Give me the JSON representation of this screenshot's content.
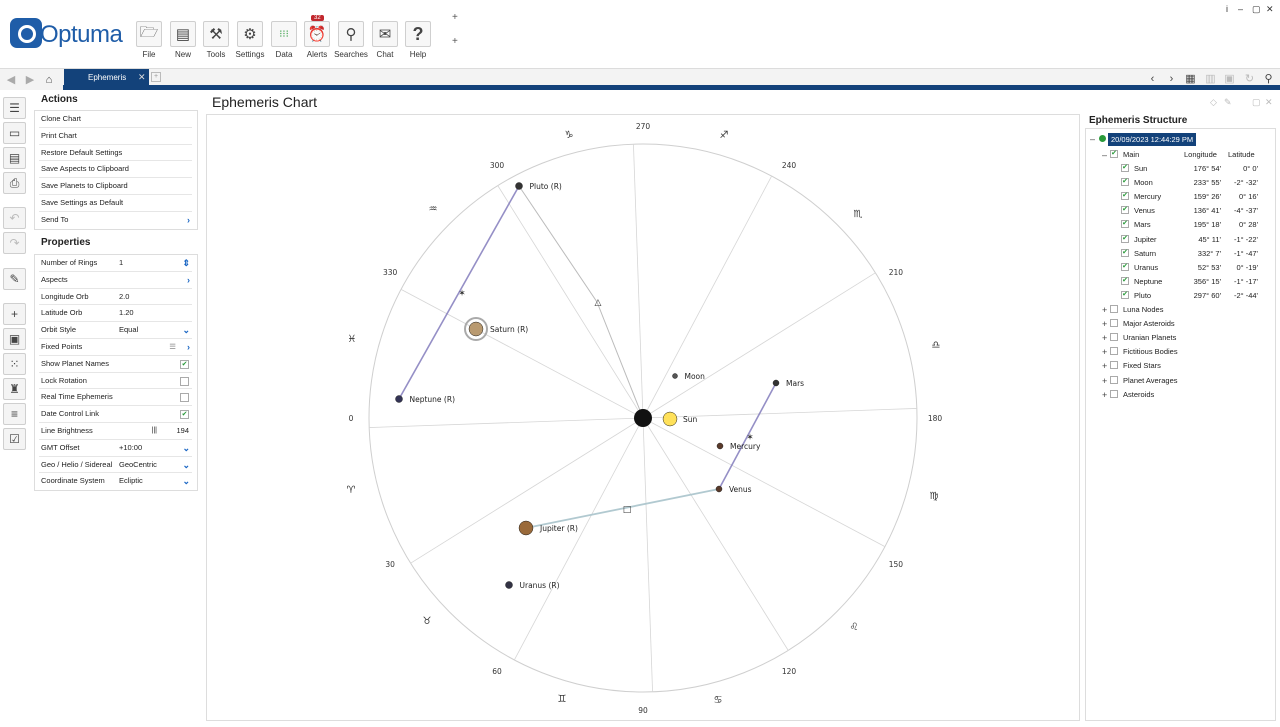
{
  "app": {
    "logo": "Optuma",
    "window_controls": [
      "i",
      "–",
      "▢",
      "✕"
    ]
  },
  "ribbon": {
    "buttons": [
      {
        "label": "File",
        "icon": "folder-icon"
      },
      {
        "label": "New",
        "icon": "new-chart-icon"
      },
      {
        "label": "Tools",
        "icon": "tools-icon"
      },
      {
        "label": "Settings",
        "icon": "gears-icon"
      },
      {
        "label": "Data",
        "icon": "binary-data-icon"
      },
      {
        "label": "Alerts",
        "icon": "alarm-clock-icon",
        "badge": "32"
      },
      {
        "label": "Searches",
        "icon": "magnifier-icon"
      },
      {
        "label": "Chat",
        "icon": "chat-bubbles-icon"
      },
      {
        "label": "Help",
        "icon": "help-icon"
      }
    ],
    "plus": "+"
  },
  "tabs": {
    "active": "Ephemeris",
    "close": "✕"
  },
  "actions": {
    "title": "Actions",
    "items": [
      "Clone Chart",
      "Print Chart",
      "Restore Default Settings",
      "Save Aspects to Clipboard",
      "Save Planets to Clipboard",
      "Save Settings as Default",
      "Send To"
    ]
  },
  "properties": {
    "title": "Properties",
    "rows": [
      {
        "label": "Number of Rings",
        "value": "1"
      },
      {
        "label": "Aspects",
        "value": ""
      },
      {
        "label": "Longitude Orb",
        "value": "2.0"
      },
      {
        "label": "Latitude Orb",
        "value": "1.20"
      },
      {
        "label": "Orbit Style",
        "value": "Equal"
      },
      {
        "label": "Fixed Points",
        "value": ""
      },
      {
        "label": "Show Planet Names",
        "value": "",
        "checked": true
      },
      {
        "label": "Lock Rotation",
        "value": "",
        "checked": false
      },
      {
        "label": "Real Time Ephemeris",
        "value": "",
        "checked": false
      },
      {
        "label": "Date Control Link",
        "value": "",
        "checked": true
      },
      {
        "label": "Line Brightness",
        "value": "194"
      },
      {
        "label": "GMT Offset",
        "value": "+10:00"
      },
      {
        "label": "Geo / Helio / Sidereal",
        "value": "GeoCentric"
      },
      {
        "label": "Coordinate System",
        "value": "Ecliptic"
      }
    ]
  },
  "chart": {
    "title": "Ephemeris Chart",
    "degree_labels": [
      "0",
      "30",
      "60",
      "90",
      "120",
      "150",
      "180",
      "210",
      "240",
      "270",
      "300",
      "330"
    ],
    "zodiac": [
      "♑",
      "♐",
      "♏",
      "♎",
      "♍",
      "♌",
      "♋",
      "♊",
      "♉",
      "♈",
      "♓",
      "♒"
    ],
    "planets": [
      {
        "name": "Pluto (R)"
      },
      {
        "name": "Saturn (R)"
      },
      {
        "name": "Neptune (R)"
      },
      {
        "name": "Moon"
      },
      {
        "name": "Sun"
      },
      {
        "name": "Mars"
      },
      {
        "name": "Mercury"
      },
      {
        "name": "Venus"
      },
      {
        "name": "Jupiter (R)"
      },
      {
        "name": "Uranus (R)"
      }
    ],
    "aspect_glyphs": [
      "✶",
      "△",
      "✶",
      "□"
    ]
  },
  "structure": {
    "title": "Ephemeris Structure",
    "date": "20/09/2023 12:44:29 PM",
    "main_label": "Main",
    "col_longitude": "Longitude",
    "col_latitude": "Latitude",
    "bodies": [
      {
        "name": "Sun",
        "lon": "176° 54'",
        "lat": "0° 0'"
      },
      {
        "name": "Moon",
        "lon": "233° 55'",
        "lat": "-2° -32'"
      },
      {
        "name": "Mercury",
        "lon": "159° 26'",
        "lat": "0° 16'"
      },
      {
        "name": "Venus",
        "lon": "136° 41'",
        "lat": "-4° -37'"
      },
      {
        "name": "Mars",
        "lon": "195° 18'",
        "lat": "0° 28'"
      },
      {
        "name": "Jupiter",
        "lon": "45° 11'",
        "lat": "-1° -22'"
      },
      {
        "name": "Saturn",
        "lon": "332° 7'",
        "lat": "-1° -47'"
      },
      {
        "name": "Uranus",
        "lon": "52° 53'",
        "lat": "0° -19'"
      },
      {
        "name": "Neptune",
        "lon": "356° 15'",
        "lat": "-1° -17'"
      },
      {
        "name": "Pluto",
        "lon": "297° 60'",
        "lat": "-2° -44'"
      }
    ],
    "groups": [
      "Luna Nodes",
      "Major Asteroids",
      "Uranian Planets",
      "Fictitious Bodies",
      "Fixed Stars",
      "Planet Averages",
      "Asteroids"
    ]
  }
}
